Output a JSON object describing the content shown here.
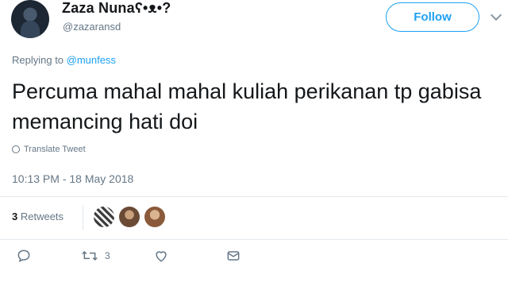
{
  "user": {
    "name": "Zaza Nunaʕ•ᴥ•?",
    "handle": "@zazaransd"
  },
  "follow_label": "Follow",
  "reply": {
    "prefix": "Replying to ",
    "mention": "@munfess"
  },
  "tweet": {
    "text": "Percuma mahal mahal kuliah perikanan tp gabisa memancing hati doi",
    "translate_label": "Translate Tweet",
    "timestamp": "10:13 PM - 18 May 2018"
  },
  "stats": {
    "retweets_count": "3",
    "retweets_label": " Retweets"
  },
  "actions": {
    "retweet_count": "3"
  },
  "icons": [
    "reply-icon",
    "retweet-icon",
    "like-icon",
    "direct-message-icon",
    "globe-icon",
    "chevron-down-icon"
  ],
  "colors": {
    "accent": "#1da1f2",
    "muted": "#657786",
    "text": "#14171a"
  }
}
